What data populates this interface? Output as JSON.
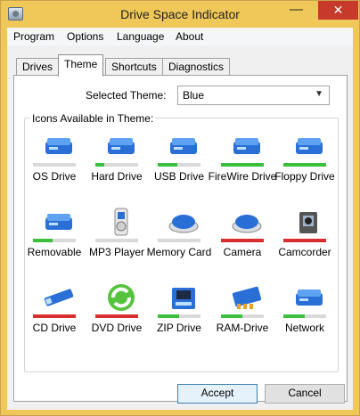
{
  "window": {
    "title": "Drive Space Indicator",
    "controls": {
      "minimize": "—",
      "maximize": "☐",
      "close": "✕"
    }
  },
  "menu": [
    "Program",
    "Options",
    "Language",
    "About"
  ],
  "tabs": [
    {
      "label": "Drives",
      "active": false
    },
    {
      "label": "Theme",
      "active": true
    },
    {
      "label": "Shortcuts",
      "active": false
    },
    {
      "label": "Diagnostics",
      "active": false
    }
  ],
  "theme": {
    "label": "Selected Theme:",
    "value": "Blue"
  },
  "icons_group": {
    "title": "Icons Available in Theme:",
    "items": [
      {
        "label": "OS Drive",
        "icon": "os-drive-icon",
        "level": 0,
        "bar_color": "#cfcfcf"
      },
      {
        "label": "Hard Drive",
        "icon": "hard-drive-icon",
        "level": 0.2,
        "bar_color": "#3cbf3c"
      },
      {
        "label": "USB Drive",
        "icon": "usb-drive-icon",
        "level": 0.45,
        "bar_color": "#3cbf3c"
      },
      {
        "label": "FireWire Drive",
        "icon": "firewire-drive-icon",
        "level": 1,
        "bar_color": "#3cbf3c"
      },
      {
        "label": "Floppy Drive",
        "icon": "floppy-drive-icon",
        "level": 1,
        "bar_color": "#3cbf3c"
      },
      {
        "label": "Removable",
        "icon": "removable-drive-icon",
        "level": 0.45,
        "bar_color": "#3cbf3c"
      },
      {
        "label": "MP3 Player",
        "icon": "mp3-player-icon",
        "level": 0,
        "bar_color": "#cfcfcf"
      },
      {
        "label": "Memory Card",
        "icon": "memory-card-icon",
        "level": 0,
        "bar_color": "#cfcfcf"
      },
      {
        "label": "Camera",
        "icon": "camera-icon",
        "level": 1,
        "bar_color": "#d92e2e"
      },
      {
        "label": "Camcorder",
        "icon": "camcorder-icon",
        "level": 1,
        "bar_color": "#d92e2e"
      },
      {
        "label": "CD Drive",
        "icon": "cd-drive-icon",
        "level": 1,
        "bar_color": "#d92e2e"
      },
      {
        "label": "DVD Drive",
        "icon": "dvd-drive-icon",
        "level": 1,
        "bar_color": "#d92e2e"
      },
      {
        "label": "ZIP Drive",
        "icon": "zip-drive-icon",
        "level": 0.5,
        "bar_color": "#3cbf3c"
      },
      {
        "label": "RAM-Drive",
        "icon": "ram-drive-icon",
        "level": 0.5,
        "bar_color": "#3cbf3c"
      },
      {
        "label": "Network",
        "icon": "network-drive-icon",
        "level": 0.5,
        "bar_color": "#3cbf3c"
      }
    ]
  },
  "buttons": {
    "accept": "Accept",
    "cancel": "Cancel"
  },
  "colors": {
    "title_bar": "#f0c85a",
    "close_button": "#c7392b",
    "accent": "#3c7fb1"
  }
}
